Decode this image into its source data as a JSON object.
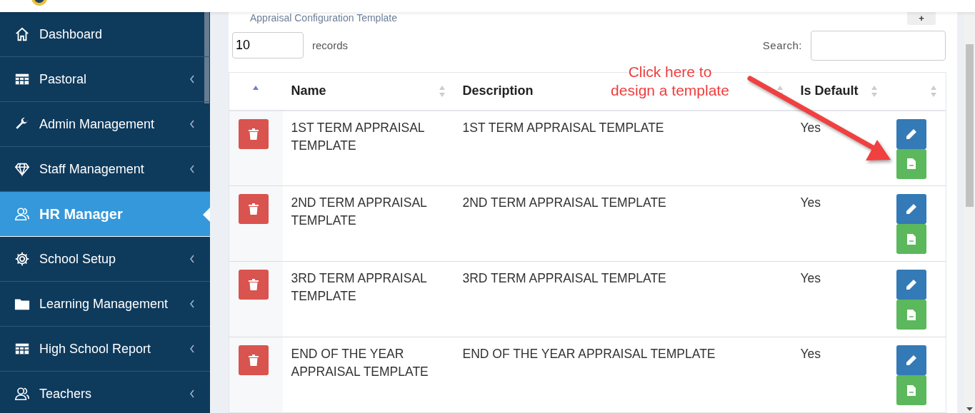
{
  "header": {
    "subtitle": "Appraisal Configuration Template",
    "add_button": "+"
  },
  "sidebar": {
    "items": [
      {
        "label": "Dashboard",
        "selected": false,
        "has_submenu": false
      },
      {
        "label": "Pastoral",
        "selected": false,
        "has_submenu": true
      },
      {
        "label": "Admin Management",
        "selected": false,
        "has_submenu": true
      },
      {
        "label": "Staff Management",
        "selected": false,
        "has_submenu": true
      },
      {
        "label": "HR Manager",
        "selected": true,
        "has_submenu": false
      },
      {
        "label": "School Setup",
        "selected": false,
        "has_submenu": true
      },
      {
        "label": "Learning Management",
        "selected": false,
        "has_submenu": true
      },
      {
        "label": "High School Report",
        "selected": false,
        "has_submenu": true
      },
      {
        "label": "Teachers",
        "selected": false,
        "has_submenu": true
      }
    ]
  },
  "length": {
    "value": "10",
    "label": "records"
  },
  "search": {
    "label": "Search:"
  },
  "table": {
    "columns": [
      {
        "sorted": true
      },
      {
        "label": "Name",
        "sorted": false
      },
      {
        "label": "Description",
        "sorted": false
      },
      {
        "label": "Is Default",
        "sorted": false
      },
      {
        "sorted": false
      }
    ],
    "rows": [
      {
        "name": "1ST TERM APPRAISAL TEMPLATE",
        "description": "1ST TERM APPRAISAL TEMPLATE",
        "is_default": "Yes"
      },
      {
        "name": "2ND TERM APPRAISAL TEMPLATE",
        "description": "2ND TERM APPRAISAL TEMPLATE",
        "is_default": "Yes"
      },
      {
        "name": "3RD TERM APPRAISAL TEMPLATE",
        "description": "3RD TERM APPRAISAL TEMPLATE",
        "is_default": "Yes"
      },
      {
        "name": "END OF THE YEAR APPRAISAL TEMPLATE",
        "description": "END OF THE YEAR APPRAISAL TEMPLATE",
        "is_default": "Yes"
      }
    ]
  },
  "annotation": {
    "lines": [
      "Click here to",
      "design a template"
    ]
  }
}
